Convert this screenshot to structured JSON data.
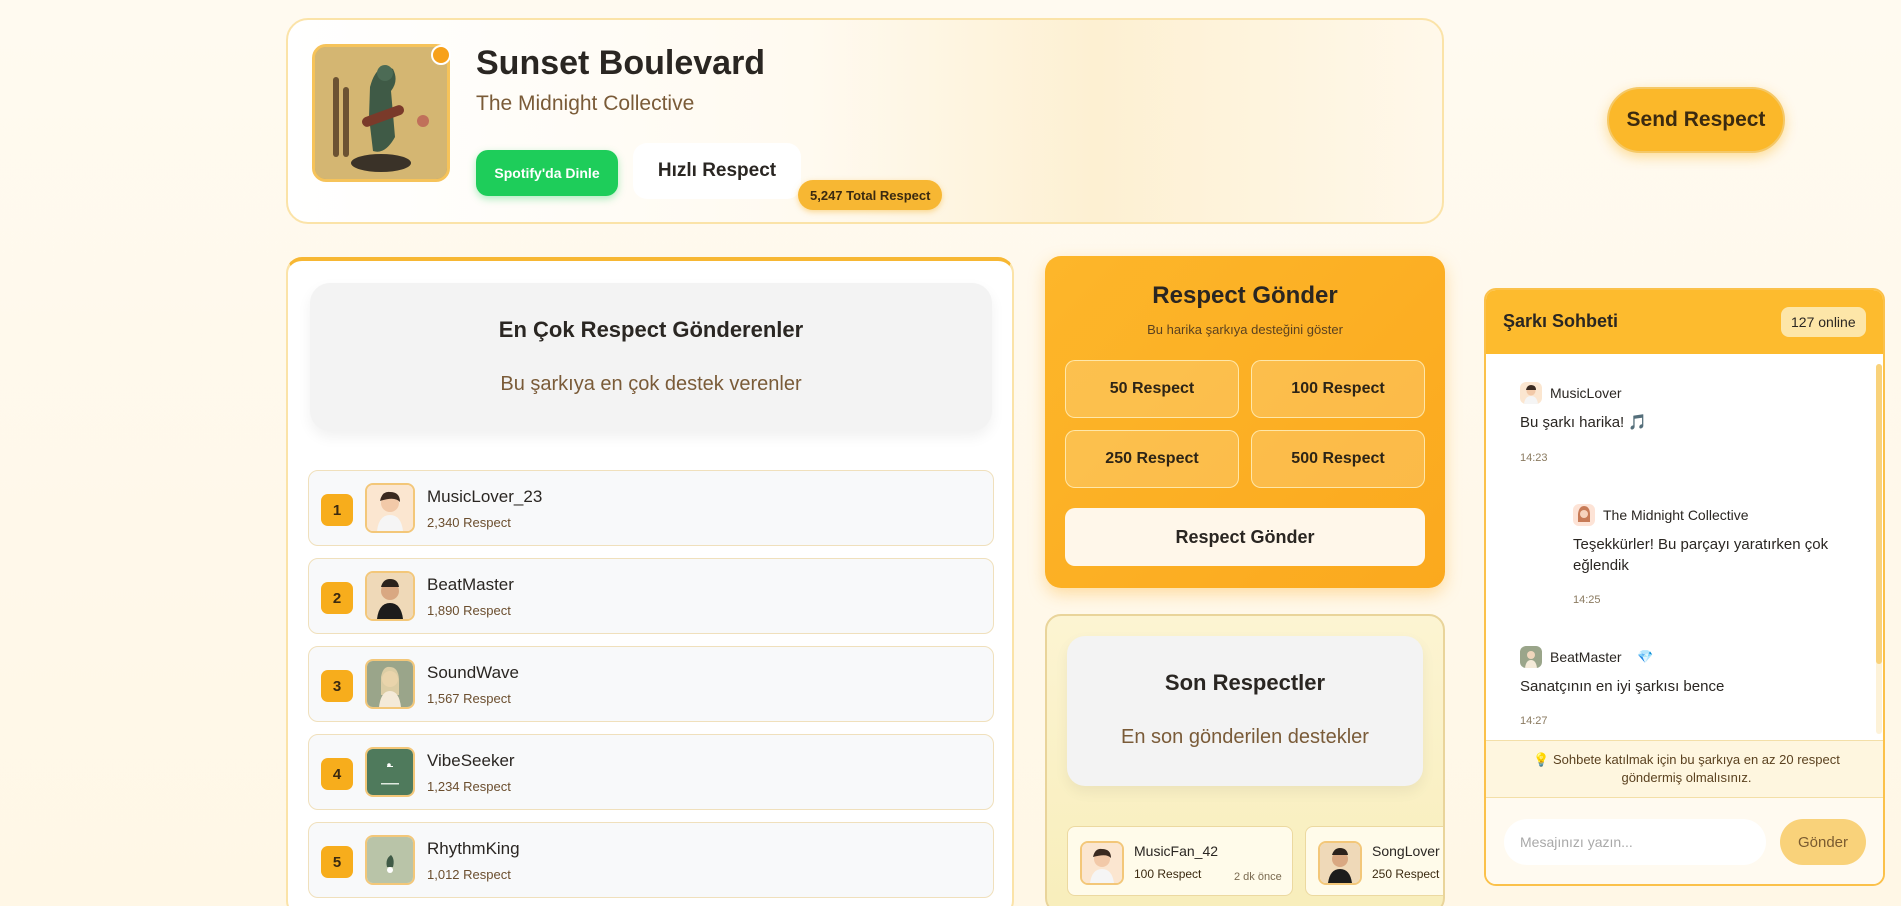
{
  "song": {
    "title": "Sunset Boulevard",
    "artist": "The Midnight Collective",
    "spotify_label": "Spotify'da Dinle",
    "quick_respect_label": "Hızlı Respect",
    "total_respect": "5,247 Total Respect"
  },
  "send_respect_top_label": "Send Respect",
  "leaderboard": {
    "title": "En Çok Respect Gönderenler",
    "subtitle": "Bu şarkıya en çok destek verenler",
    "entries": [
      {
        "rank": "1",
        "name": "MusicLover_23",
        "score": "2,340 Respect"
      },
      {
        "rank": "2",
        "name": "BeatMaster",
        "score": "1,890 Respect"
      },
      {
        "rank": "3",
        "name": "SoundWave",
        "score": "1,567 Respect"
      },
      {
        "rank": "4",
        "name": "VibeSeeker",
        "score": "1,234 Respect"
      },
      {
        "rank": "5",
        "name": "RhythmKing",
        "score": "1,012 Respect"
      }
    ]
  },
  "send_panel": {
    "title": "Respect Gönder",
    "subtitle": "Bu harika şarkıya desteğini göster",
    "amounts": [
      "50 Respect",
      "100 Respect",
      "250 Respect",
      "500 Respect"
    ],
    "submit_label": "Respect Gönder"
  },
  "recent": {
    "title": "Son Respectler",
    "subtitle": "En son gönderilen destekler",
    "items": [
      {
        "name": "MusicFan_42",
        "amount": "100 Respect",
        "time": "2 dk önce"
      },
      {
        "name": "SongLover",
        "amount": "250 Respect",
        "time": ""
      }
    ]
  },
  "chat": {
    "title": "Şarkı Sohbeti",
    "online": "127 online",
    "messages": [
      {
        "author": "MusicLover",
        "text": "Bu şarkı harika! 🎵",
        "time": "14:23"
      },
      {
        "author": "The Midnight Collective",
        "text": "Teşekkürler! Bu parçayı yaratırken çok eğlendik",
        "time": "14:25"
      },
      {
        "author": "BeatMaster",
        "badge": "💎",
        "text": "Sanatçının en iyi şarkısı bence",
        "time": "14:27"
      }
    ],
    "notice": "💡 Sohbete katılmak için bu şarkıya en az 20 respect göndermiş olmalısınız.",
    "input_placeholder": "Mesajınızı yazın...",
    "send_label": "Gönder"
  },
  "colors": {
    "accent": "#fbb82a",
    "spotify": "#1ecd5a",
    "background": "#fff8ea"
  }
}
